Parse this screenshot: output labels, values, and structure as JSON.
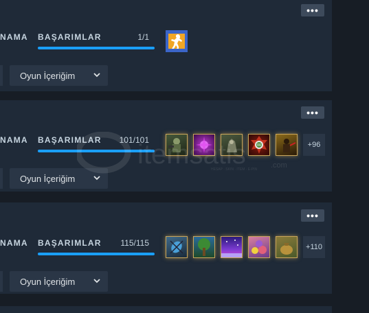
{
  "more_glyph": "•••",
  "games": [
    {
      "fragment": "NAMA",
      "ach_label": "BAŞARIMLAR",
      "count": "1/1",
      "progress": 1.0,
      "content_button": "Oyun İçeriğim",
      "extra": "",
      "icons": [
        "cs-logo-icon"
      ]
    },
    {
      "fragment": "NAMA",
      "ach_label": "BAŞARIMLAR",
      "count": "101/101",
      "progress": 1.0,
      "content_button": "Oyun İçeriğim",
      "extra": "+96",
      "icons": [
        "soldier-achievement-icon",
        "purple-burst-achievement-icon",
        "creature-achievement-icon",
        "target-badge-achievement-icon",
        "dust-warrior-achievement-icon"
      ]
    },
    {
      "fragment": "NAMA",
      "ach_label": "BAŞARIMLAR",
      "count": "115/115",
      "progress": 1.0,
      "content_button": "Oyun İçeriğim",
      "extra": "+110",
      "icons": [
        "beetle-achievement-icon",
        "tree-achievement-icon",
        "sky-achievement-icon",
        "candy-achievement-icon",
        "sack-achievement-icon"
      ]
    }
  ],
  "watermark": {
    "brand": "itemsatis",
    "tld": ".com",
    "tagline": "HESAP · SKIN · ITEM · E-PIN"
  }
}
